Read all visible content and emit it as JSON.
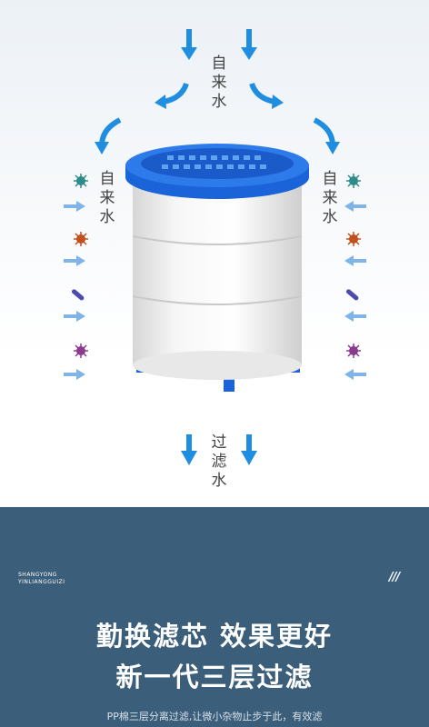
{
  "labels": {
    "top_in": "自来水",
    "left_in": "自来水",
    "right_in": "自来水",
    "bottom_out": "过滤水"
  },
  "brand": {
    "line1": "SHANGYONG",
    "line2": "YINLIANGGUIZI",
    "slashes": "///"
  },
  "headline": {
    "line1": "勤换滤芯 效果更好",
    "line2": "新一代三层过滤"
  },
  "description": "PP棉三层分离过滤,让微小杂物止步于此，有效滤",
  "colors": {
    "arrow": "#1f8ee0",
    "filter_cap": "#1b63d8",
    "panel": "#3b5e7a",
    "text": "#ffffff"
  }
}
